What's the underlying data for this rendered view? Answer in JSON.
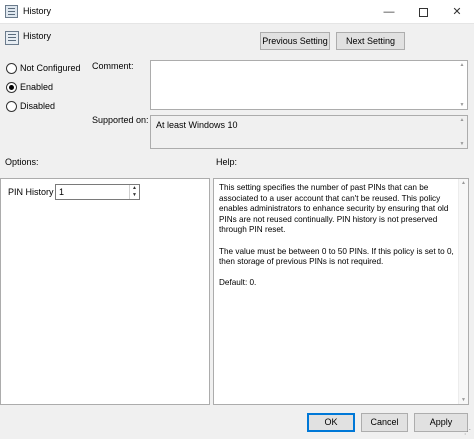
{
  "window": {
    "title": "History",
    "minimize_glyph": "—",
    "close_glyph": "✕",
    "grip_glyph": "⋰"
  },
  "policy": {
    "name": "History",
    "prev_button": "Previous Setting",
    "next_button": "Next Setting"
  },
  "state": {
    "options": [
      {
        "label": "Not Configured",
        "selected": false
      },
      {
        "label": "Enabled",
        "selected": true
      },
      {
        "label": "Disabled",
        "selected": false
      }
    ]
  },
  "comment": {
    "label": "Comment:",
    "value": ""
  },
  "supported": {
    "label": "Supported on:",
    "value": "At least Windows 10"
  },
  "options_panel": {
    "title": "Options:",
    "pin_history_label": "PIN History",
    "pin_history_value": "1"
  },
  "help_panel": {
    "title": "Help:",
    "paragraphs": [
      "This setting specifies the number of past PINs that can be associated to a user account that can't be reused. This policy enables administrators to enhance security by ensuring that old PINs are not reused continually. PIN history is not preserved through PIN reset.",
      "The value must be between 0 to 50 PINs. If this policy is set to 0, then storage of previous PINs is not required.",
      "Default: 0."
    ]
  },
  "footer": {
    "ok": "OK",
    "cancel": "Cancel",
    "apply": "Apply"
  },
  "icons": {
    "scroll_up": "▲",
    "scroll_down": "▼"
  }
}
